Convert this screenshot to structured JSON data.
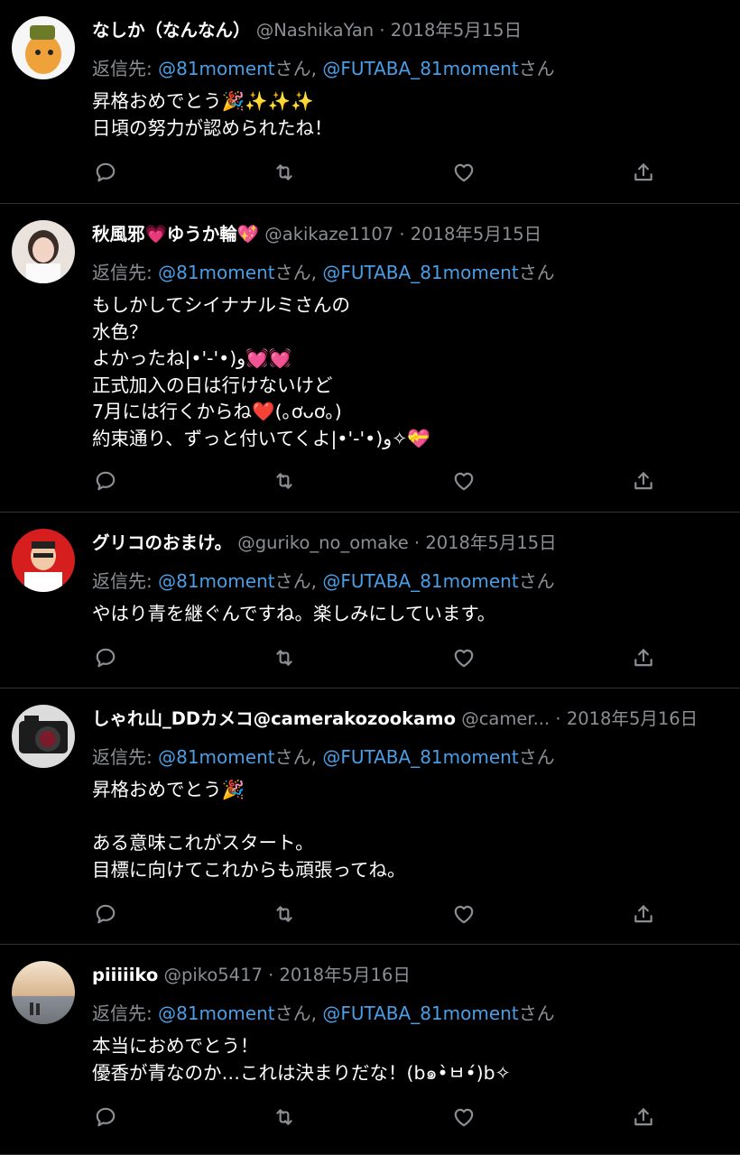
{
  "reply_prefix": "返信先:",
  "separator": "·",
  "tweets": [
    {
      "name": "なしか（なんなん）",
      "handle": "@NashikaYan",
      "date": "2018年5月15日",
      "reply_mentions": [
        "@81moment",
        "@FUTABA_81moment"
      ],
      "reply_suffix": "さん",
      "reply_comma": ",",
      "lines": [
        "昇格おめでとう🎉✨✨✨",
        "日頃の努力が認められたね！"
      ]
    },
    {
      "name": "秋風邪💗ゆうか輪💖",
      "handle": "@akikaze1107",
      "date": "2018年5月15日",
      "reply_mentions": [
        "@81moment",
        "@FUTABA_81moment"
      ],
      "reply_suffix": "さん",
      "reply_comma": ",",
      "lines": [
        "もしかしてシイナナルミさんの",
        "水色？",
        "よかったね|•'-'•)و💓💓",
        "正式加入の日は行けないけど",
        "7月には行くからね❤️(｡ơᴗơ｡)",
        "約束通り、ずっと付いてくよ|•'-'•)و✧💝"
      ]
    },
    {
      "name": "グリコのおまけ。",
      "handle": "@guriko_no_omake",
      "date": "2018年5月15日",
      "reply_mentions": [
        "@81moment",
        "@FUTABA_81moment"
      ],
      "reply_suffix": "さん",
      "reply_comma": ",",
      "lines": [
        "やはり青を継ぐんですね。楽しみにしています。"
      ]
    },
    {
      "name": "しゃれ山_DDカメコ@camerakozookamo",
      "handle": "@camer...",
      "date": "2018年5月16日",
      "reply_mentions": [
        "@81moment",
        "@FUTABA_81moment"
      ],
      "reply_suffix": "さん",
      "reply_comma": ",",
      "lines": [
        "昇格おめでとう🎉",
        "",
        "ある意味これがスタート。",
        "目標に向けてこれからも頑張ってね。"
      ]
    },
    {
      "name": "piiiiiko",
      "handle": "@piko5417",
      "date": "2018年5月16日",
      "reply_mentions": [
        "@81moment",
        "@FUTABA_81moment"
      ],
      "reply_suffix": "さん",
      "reply_comma": ",",
      "lines": [
        "本当におめでとう！",
        "優香が青なのか…これは決まりだな！(b๑•̀ㅂ•́)b✧"
      ]
    }
  ],
  "icons": {
    "reply": "reply-icon",
    "retweet": "retweet-icon",
    "like": "like-icon",
    "share": "share-icon"
  },
  "colors": {
    "background": "#000000",
    "text": "#ffffff",
    "secondary": "#8b8f94",
    "mention": "#4b9ee6",
    "divider": "#2f3336"
  }
}
